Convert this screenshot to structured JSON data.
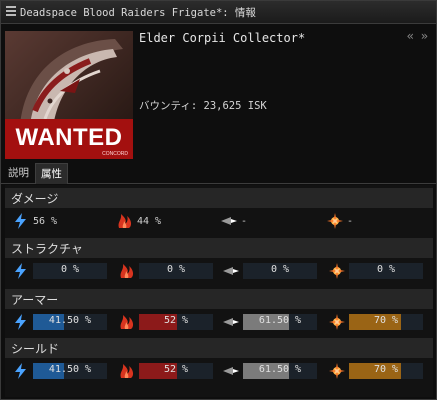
{
  "window": {
    "title": "Deadspace Blood Raiders Frigate*: 情報"
  },
  "header": {
    "ship_name": "Elder Corpii Collector*",
    "bounty": "バウンティ: 23,625 ISK",
    "wanted_label": "WANTED",
    "wanted_sub": "CONCORD"
  },
  "tabs": [
    {
      "label": "説明"
    },
    {
      "label": "属性"
    }
  ],
  "damage": {
    "title": "ダメージ",
    "values": [
      "56 %",
      "44 %",
      "-",
      "-"
    ],
    "icons": [
      "em-damage-icon",
      "thermal-damage-icon",
      "kinetic-damage-icon",
      "explosive-damage-icon"
    ]
  },
  "structure": {
    "title": "ストラクチャ",
    "values": [
      "0 %",
      "0 %",
      "0 %",
      "0 %"
    ],
    "fills": [
      0,
      0,
      0,
      0
    ]
  },
  "armor": {
    "title": "アーマー",
    "values": [
      "41.50 %",
      "52 %",
      "61.50 %",
      "70 %"
    ],
    "fills": [
      0.415,
      0.52,
      0.615,
      0.7
    ]
  },
  "shield": {
    "title": "シールド",
    "values": [
      "41.50 %",
      "52 %",
      "61.50 %",
      "70 %"
    ],
    "fills": [
      0.415,
      0.52,
      0.615,
      0.7
    ]
  },
  "colors": {
    "em": "#1f5a96",
    "thermal": "#8c1a1a",
    "kinetic": "#7b7b7b",
    "explosive": "#9a6415",
    "bar_bg": "#1b222a"
  }
}
